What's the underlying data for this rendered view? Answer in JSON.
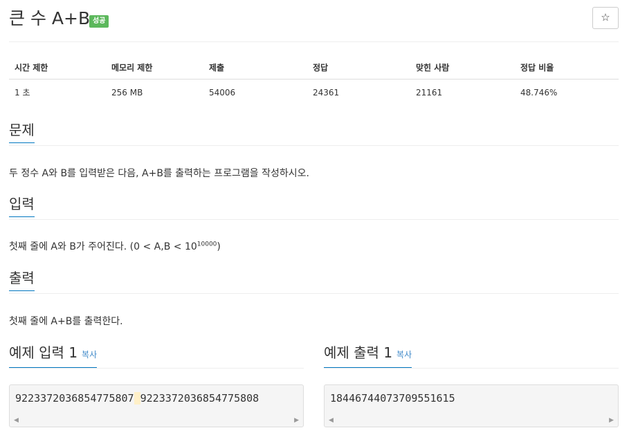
{
  "problem": {
    "title": "큰 수 A+B",
    "badge": "성공",
    "star_icon": "☆"
  },
  "info": {
    "headers": [
      "시간 제한",
      "메모리 제한",
      "제출",
      "정답",
      "맞힌 사람",
      "정답 비율"
    ],
    "values": [
      "1 초",
      "256 MB",
      "54006",
      "24361",
      "21161",
      "48.746%"
    ]
  },
  "sections": {
    "problem": {
      "heading": "문제",
      "text": "두 정수 A와 B를 입력받은 다음, A+B를 출력하는 프로그램을 작성하시오."
    },
    "input": {
      "heading": "입력",
      "text": "첫째 줄에 A와 B가 주어진다. (0 < A,B < 10",
      "sup": "10000",
      "text_end": ")"
    },
    "output": {
      "heading": "출력",
      "text": "첫째 줄에 A+B를 출력한다."
    }
  },
  "examples": {
    "input_heading": "예제 입력 1",
    "output_heading": "예제 출력 1",
    "copy_label": "복사",
    "input_a": "9223372036854775807",
    "input_space": " ",
    "input_b": "9223372036854775808",
    "output_value": "18446744073709551615"
  },
  "colors": {
    "accent": "#0076c0",
    "badge": "#5cb85c",
    "link": "#428bca"
  }
}
